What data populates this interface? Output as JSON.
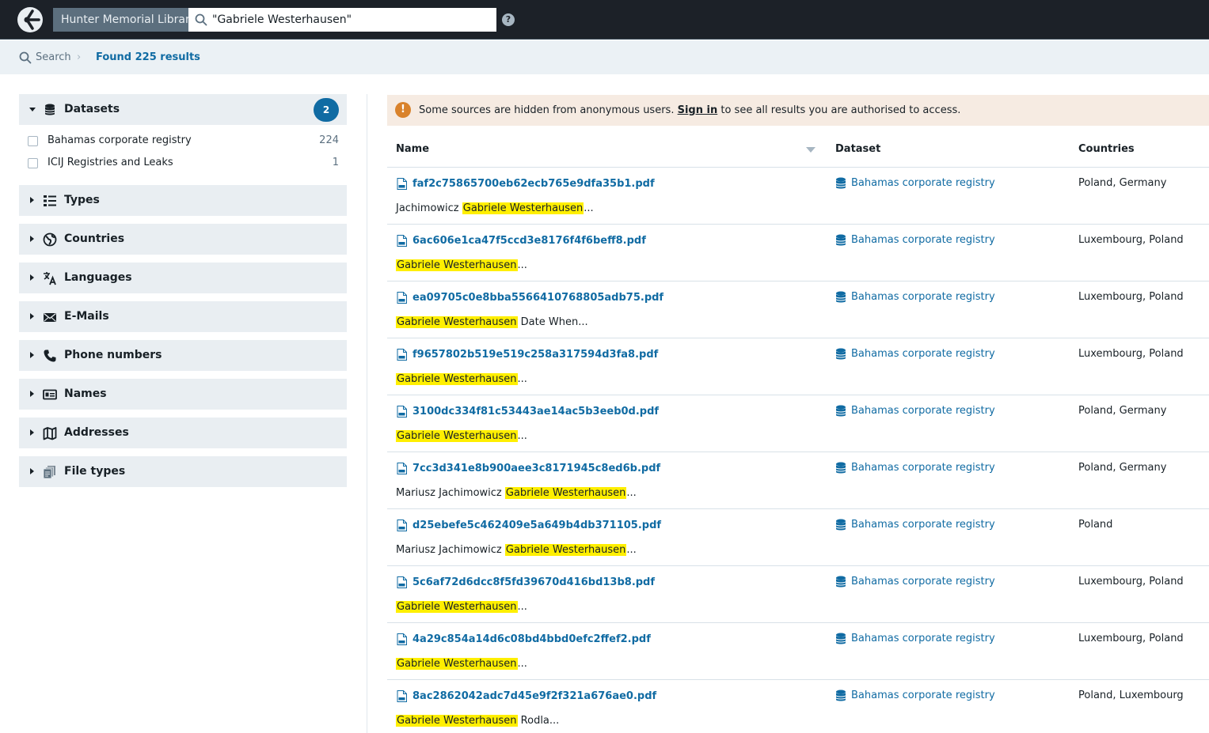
{
  "navbar": {
    "scope_label": "Hunter Memorial Library",
    "search_value": "\"Gabriele Westerhausen\"",
    "help_glyph": "?"
  },
  "breadcrumb": {
    "search_label": "Search",
    "separator": "›",
    "results_label": "Found 225 results"
  },
  "sidebar": {
    "datasets": {
      "label": "Datasets",
      "count": "2",
      "options": [
        {
          "label": "Bahamas corporate registry",
          "count": "224"
        },
        {
          "label": "ICIJ Registries and Leaks",
          "count": "1"
        }
      ]
    },
    "facets": [
      {
        "label": "Types",
        "icon": "list-icon"
      },
      {
        "label": "Countries",
        "icon": "globe-icon"
      },
      {
        "label": "Languages",
        "icon": "translate-icon"
      },
      {
        "label": "E-Mails",
        "icon": "envelope-icon"
      },
      {
        "label": "Phone numbers",
        "icon": "phone-icon"
      },
      {
        "label": "Names",
        "icon": "id-card-icon"
      },
      {
        "label": "Addresses",
        "icon": "map-icon"
      },
      {
        "label": "File types",
        "icon": "documents-icon"
      }
    ]
  },
  "callout": {
    "icon": "!",
    "text_before": "Some sources are hidden from anonymous users.",
    "link": "Sign in",
    "text_after": "to see all results you are authorised to access."
  },
  "table": {
    "headers": {
      "name": "Name",
      "dataset": "Dataset",
      "countries": "Countries"
    },
    "rows": [
      {
        "file": "faf2c75865700eb62ecb765e9dfa35b1.pdf",
        "pre": "Jachimowicz ",
        "hl": "Gabriele Westerhausen",
        "post": "...",
        "dataset": "Bahamas corporate registry",
        "countries": "Poland, Germany"
      },
      {
        "file": "6ac606e1ca47f5ccd3e8176f4f6beff8.pdf",
        "pre": "",
        "hl": "Gabriele Westerhausen",
        "post": "...",
        "dataset": "Bahamas corporate registry",
        "countries": "Luxembourg, Poland"
      },
      {
        "file": "ea09705c0e8bba5566410768805adb75.pdf",
        "pre": "",
        "hl": "Gabriele Westerhausen",
        "post": " Date When...",
        "dataset": "Bahamas corporate registry",
        "countries": "Luxembourg, Poland"
      },
      {
        "file": "f9657802b519e519c258a317594d3fa8.pdf",
        "pre": "",
        "hl": "Gabriele Westerhausen",
        "post": "...",
        "dataset": "Bahamas corporate registry",
        "countries": "Luxembourg, Poland"
      },
      {
        "file": "3100dc334f81c53443ae14ac5b3eeb0d.pdf",
        "pre": "",
        "hl": "Gabriele Westerhausen",
        "post": "...",
        "dataset": "Bahamas corporate registry",
        "countries": "Poland, Germany"
      },
      {
        "file": "7cc3d341e8b900aee3c8171945c8ed6b.pdf",
        "pre": "Mariusz Jachimowicz ",
        "hl": "Gabriele Westerhausen",
        "post": "...",
        "dataset": "Bahamas corporate registry",
        "countries": "Poland, Germany"
      },
      {
        "file": "d25ebefe5c462409e5a649b4db371105.pdf",
        "pre": "Mariusz Jachimowicz ",
        "hl": "Gabriele Westerhausen",
        "post": "...",
        "dataset": "Bahamas corporate registry",
        "countries": "Poland"
      },
      {
        "file": "5c6af72d6dcc8f5fd39670d416bd13b8.pdf",
        "pre": "",
        "hl": "Gabriele Westerhausen",
        "post": "...",
        "dataset": "Bahamas corporate registry",
        "countries": "Luxembourg, Poland"
      },
      {
        "file": "4a29c854a14d6c08bd4bbd0efc2ffef2.pdf",
        "pre": "",
        "hl": "Gabriele Westerhausen",
        "post": "...",
        "dataset": "Bahamas corporate registry",
        "countries": "Luxembourg, Poland"
      },
      {
        "file": "8ac2862042adc7d45e9f2f321a676ae0.pdf",
        "pre": "",
        "hl": "Gabriele Westerhausen",
        "post": " Rodla...",
        "dataset": "Bahamas corporate registry",
        "countries": "Poland, Luxembourg"
      }
    ]
  },
  "colors": {
    "navbar_bg": "#1c2128",
    "accent": "#106ba3",
    "highlight": "#ffef00",
    "warning": "#d9822b"
  }
}
